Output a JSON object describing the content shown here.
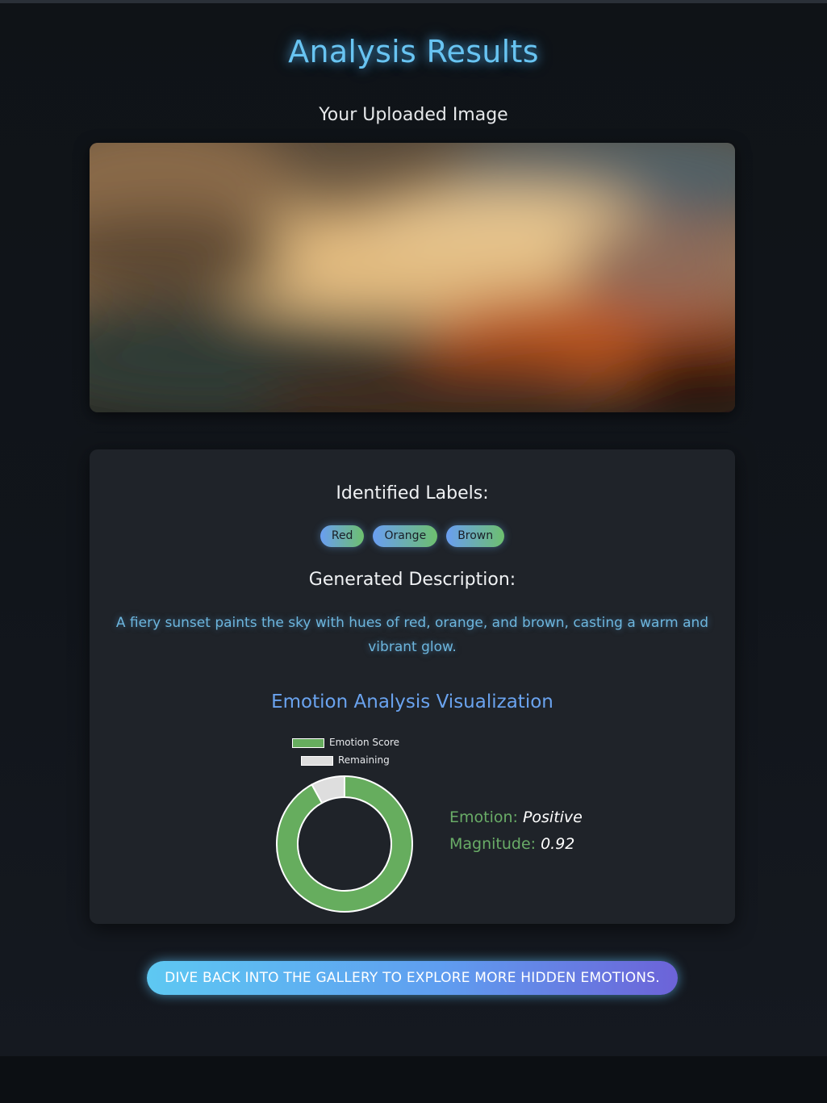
{
  "header": {
    "title": "Analysis Results",
    "subtitle": "Your Uploaded Image"
  },
  "results": {
    "labels_heading": "Identified Labels:",
    "labels": [
      "Red",
      "Orange",
      "Brown"
    ],
    "description_heading": "Generated Description:",
    "description": "A fiery sunset paints the sky with hues of red, orange, and brown, casting a warm and vibrant glow.",
    "chart_title": "Emotion Analysis Visualization",
    "emotion_label": "Emotion:",
    "emotion_value": "Positive",
    "magnitude_label": "Magnitude:",
    "magnitude_value": "0.92"
  },
  "chart_data": {
    "type": "pie",
    "variant": "doughnut",
    "categories": [
      "Emotion Score",
      "Remaining"
    ],
    "values": [
      0.92,
      0.08
    ],
    "colors": [
      "#66ad5e",
      "#dedede"
    ],
    "legend_placement": "top"
  },
  "actions": {
    "back_button": "Dive back into the gallery to explore more hidden emotions."
  }
}
